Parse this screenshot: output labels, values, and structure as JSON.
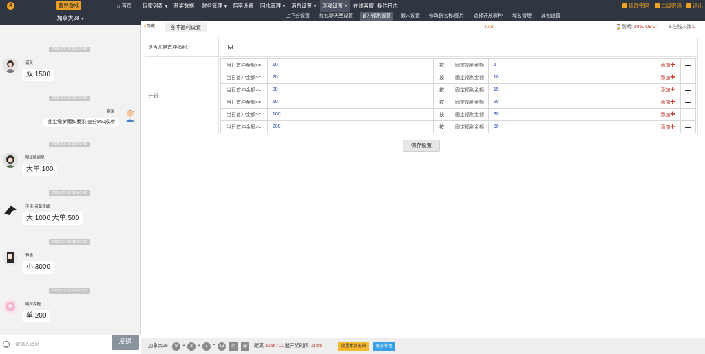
{
  "top_nav": {
    "logo": "A",
    "pause_button": "暂停游戏",
    "items": [
      {
        "label": "首页",
        "icon": "home-icon"
      },
      {
        "label": "玩家列表",
        "dropdown": true
      },
      {
        "label": "开奖数据"
      },
      {
        "label": "财务管理",
        "dropdown": true
      },
      {
        "label": "赔率设置"
      },
      {
        "label": "回水管理",
        "dropdown": true
      },
      {
        "label": "消息设置",
        "dropdown": true
      },
      {
        "label": "游戏设置",
        "dropdown": true,
        "active": true
      },
      {
        "label": "在线客服"
      },
      {
        "label": "操作日志"
      }
    ],
    "right_links": [
      {
        "label": "修改密码",
        "icon": "edit-icon"
      },
      {
        "label": "二级密码",
        "icon": "edit-icon"
      },
      {
        "label": "退出",
        "icon": "logout-icon"
      }
    ]
  },
  "sub_nav": {
    "items": [
      {
        "label": "上下分设置"
      },
      {
        "label": "红包聊天室设置"
      },
      {
        "label": "首冲福利设置",
        "active": true
      },
      {
        "label": "假人设置"
      },
      {
        "label": "修改群名称/图片"
      },
      {
        "label": "选择开放彩种"
      },
      {
        "label": "域名管理"
      },
      {
        "label": "其他设置"
      }
    ]
  },
  "sidebar": {
    "header": "加拿大28",
    "messages": [
      {
        "time": "2025-03-03 12:43:38",
        "user": "诺英",
        "text": "双:1500",
        "side": "left"
      },
      {
        "time": "2025-03-03 12:43:39",
        "user": "春晓",
        "text": "@尘缘梦雨如墨染,查分950成功",
        "side": "right"
      },
      {
        "time": "2025-03-03 12:43:41",
        "user": "隔岸鹅阙尼",
        "text": "大单:100",
        "side": "left"
      },
      {
        "time": "2025-03-03 12:43:47",
        "user": "不诺°者莫须城",
        "text": "大:1000 大单:500",
        "side": "left"
      },
      {
        "time": "2025-03-03 12:43:50",
        "user": "雅墨",
        "text": "小:3000",
        "side": "left"
      },
      {
        "time": "2025-03-03 12:43:52",
        "user": "明自森檀",
        "text": "单:200",
        "side": "left"
      }
    ],
    "input_placeholder": "请输入消息",
    "send_label": "发送"
  },
  "tabs": {
    "back_label": "隐藏",
    "current_tab": "首冲福利设置",
    "center_value": "400I",
    "expire_label": "到期:",
    "expire_date": "2050-09-27",
    "online_label": "在线人数:",
    "online_count": "0"
  },
  "form": {
    "enable_label": "是否开启首冲福利:",
    "enabled": true,
    "plan_label": "计划:",
    "plan_rows": [
      {
        "cond_label": "当日首冲金额>=",
        "amount": "10",
        "op": "按",
        "bonus_label": "固定福利金额",
        "bonus": "5",
        "add_label": "添加",
        "remove_label": "—"
      },
      {
        "cond_label": "当日首冲金额>=",
        "amount": "20",
        "op": "按",
        "bonus_label": "固定福利金额",
        "bonus": "10",
        "add_label": "添加",
        "remove_label": "—"
      },
      {
        "cond_label": "当日首冲金额>=",
        "amount": "30",
        "op": "按",
        "bonus_label": "固定福利金额",
        "bonus": "15",
        "add_label": "添加",
        "remove_label": "—"
      },
      {
        "cond_label": "当日首冲金额>=",
        "amount": "50",
        "op": "按",
        "bonus_label": "固定福利金额",
        "bonus": "20",
        "add_label": "添加",
        "remove_label": "—"
      },
      {
        "cond_label": "当日首冲金额>=",
        "amount": "100",
        "op": "按",
        "bonus_label": "固定福利金额",
        "bonus": "30",
        "add_label": "添加",
        "remove_label": "—"
      },
      {
        "cond_label": "当日首冲金额>=",
        "amount": "200",
        "op": "按",
        "bonus_label": "固定福利金额",
        "bonus": "50",
        "add_label": "添加",
        "remove_label": "—"
      }
    ],
    "save_label": "保存设置"
  },
  "bottom": {
    "game": "加拿大28",
    "balls": [
      "9",
      "3",
      "1"
    ],
    "plus": "+",
    "equals": "=",
    "sum": "13",
    "result_size": "小",
    "result_parity": "单",
    "distance_label": "距离",
    "period": "3256711",
    "countdown_label": "期开奖时间",
    "countdown": "01:56",
    "btn_no_draw": "设置本期无效",
    "btn_contact": "联系作者"
  }
}
